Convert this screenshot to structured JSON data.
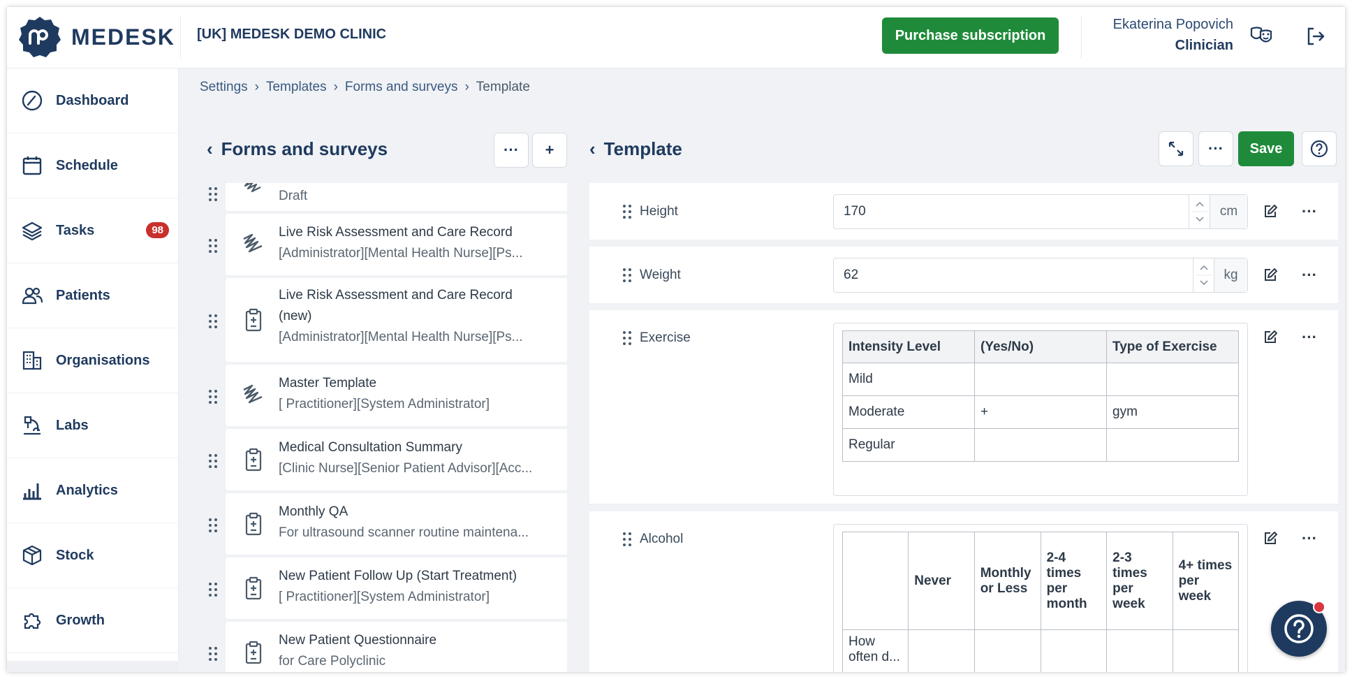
{
  "header": {
    "brand": "MEDESK",
    "clinic": "[UK] MEDESK DEMO CLINIC",
    "purchase_label": "Purchase subscription",
    "user_name": "Ekaterina Popovich",
    "user_role": "Clinician",
    "icons": [
      "theatre-masks-icon",
      "logout-icon"
    ]
  },
  "sidebar": {
    "items": [
      {
        "label": "Dashboard",
        "icon": "gauge-icon"
      },
      {
        "label": "Schedule",
        "icon": "calendar-icon"
      },
      {
        "label": "Tasks",
        "icon": "layers-icon",
        "badge": "98"
      },
      {
        "label": "Patients",
        "icon": "users-icon"
      },
      {
        "label": "Organisations",
        "icon": "building-icon"
      },
      {
        "label": "Labs",
        "icon": "microscope-icon"
      },
      {
        "label": "Analytics",
        "icon": "bar-chart-icon"
      },
      {
        "label": "Stock",
        "icon": "box-icon"
      },
      {
        "label": "Growth",
        "icon": "puzzle-icon"
      }
    ]
  },
  "breadcrumb": [
    "Settings",
    "Templates",
    "Forms and surveys",
    "Template"
  ],
  "forms_panel": {
    "title": "Forms and surveys",
    "items": [
      {
        "title": "",
        "sub": "Draft",
        "icon": "scribble-icon"
      },
      {
        "title": "Live Risk Assessment and Care Record",
        "sub": "[Administrator][Mental Health Nurse][Ps...",
        "icon": "scribble-icon"
      },
      {
        "title": "Live Risk Assessment and Care Record",
        "title2": "(new)",
        "sub": "[Administrator][Mental Health Nurse][Ps...",
        "icon": "clipboard-icon"
      },
      {
        "title": "Master Template",
        "sub": "[ Practitioner][System Administrator]",
        "icon": "scribble-icon"
      },
      {
        "title": "Medical Consultation Summary",
        "sub": "[Clinic Nurse][Senior Patient Advisor][Acc...",
        "icon": "clipboard-icon"
      },
      {
        "title": "Monthly QA",
        "sub": "For ultrasound scanner routine maintena...",
        "icon": "clipboard-icon"
      },
      {
        "title": "New Patient Follow Up (Start Treatment)",
        "sub": "[ Practitioner][System Administrator]",
        "icon": "clipboard-icon"
      },
      {
        "title": "New Patient Questionnaire",
        "sub": "for Care Polyclinic",
        "icon": "clipboard-icon"
      }
    ]
  },
  "template_panel": {
    "title": "Template",
    "save_label": "Save",
    "fields": {
      "height": {
        "label": "Height",
        "value": "170",
        "unit": "cm"
      },
      "weight": {
        "label": "Weight",
        "value": "62",
        "unit": "kg"
      },
      "exercise": {
        "label": "Exercise",
        "headers": [
          "Intensity Level",
          "(Yes/No)",
          "Type of Exercise"
        ],
        "rows": [
          [
            "Mild",
            "",
            ""
          ],
          [
            "Moderate",
            "+",
            "gym"
          ],
          [
            "Regular",
            "",
            ""
          ]
        ]
      },
      "alcohol": {
        "label": "Alcohol",
        "headers": [
          "",
          "Never",
          "Monthly or Less",
          "2-4 times per month",
          "2-3 times per week",
          "4+ times per week"
        ],
        "first_cell": "How often d..."
      }
    }
  }
}
